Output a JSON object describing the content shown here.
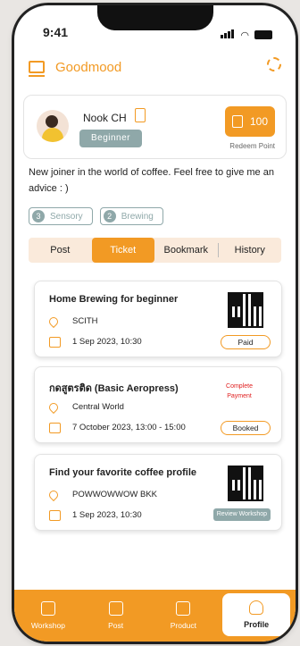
{
  "status_bar": {
    "time": "9:41"
  },
  "app": {
    "title": "Goodmood"
  },
  "profile": {
    "name": "Nook CH",
    "level": "Beginner",
    "points": "100",
    "redeem_label": "Redeem Point",
    "bio": "New joiner in the world of coffee. Feel free to give me an advice : )"
  },
  "chips": [
    {
      "count": "3",
      "label": "Sensory"
    },
    {
      "count": "2",
      "label": "Brewing"
    }
  ],
  "tabs": [
    {
      "label": "Post"
    },
    {
      "label": "Ticket"
    },
    {
      "label": "Bookmark"
    },
    {
      "label": "History"
    }
  ],
  "active_tab": "Ticket",
  "tickets": [
    {
      "title": "Home Brewing for beginner",
      "location": "SCITH",
      "date": "1 Sep 2023, 10:30",
      "status": "Paid"
    },
    {
      "title": "กดสูตรติด (Basic Aeropress)",
      "location": "Central World",
      "date": "7 October 2023, 13:00 - 15:00",
      "note": "Complete Payment",
      "status": "Booked"
    },
    {
      "title": "Find your favorite coffee profile",
      "location": "POWWOWWOW BKK",
      "date": "1 Sep 2023, 10:30",
      "status": "Review Workshop"
    }
  ],
  "nav": [
    {
      "label": "Workshop",
      "icon": "calendar-icon"
    },
    {
      "label": "Post",
      "icon": "chat-icon"
    },
    {
      "label": "Product",
      "icon": "bag-icon"
    },
    {
      "label": "Profile",
      "icon": "user-icon"
    }
  ],
  "colors": {
    "accent": "#f29a24",
    "muted": "#8fa8a9",
    "alert": "#e02020"
  }
}
